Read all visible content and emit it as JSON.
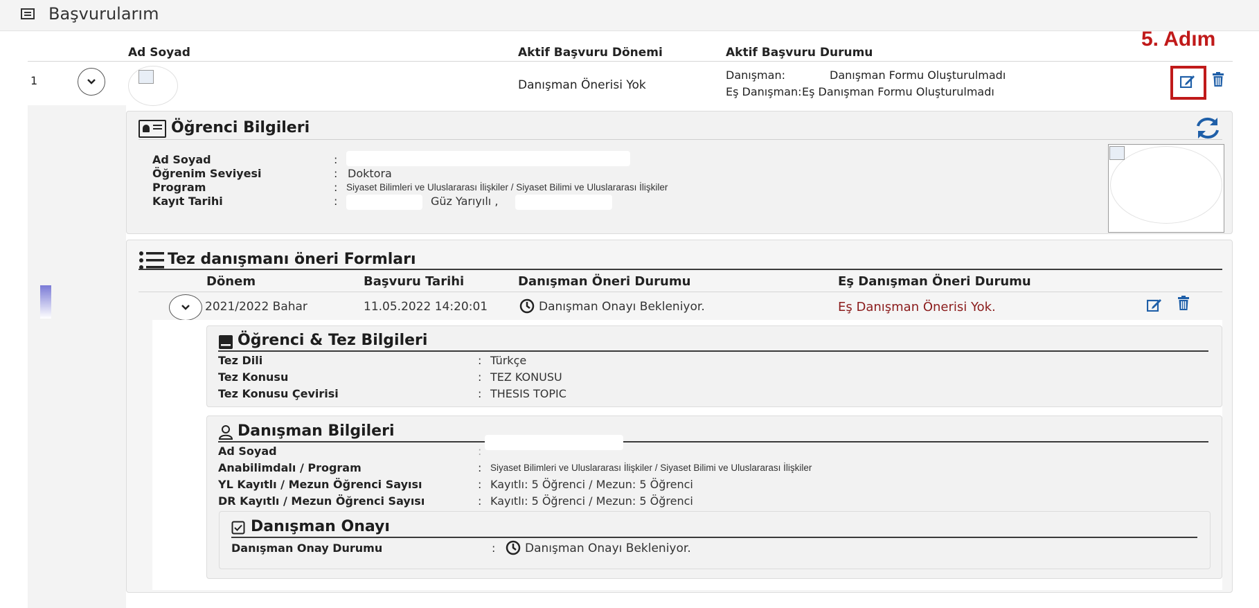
{
  "header": {
    "title": "Başvurularım",
    "icon": "list-icon"
  },
  "annotation": {
    "step_label": "5. Adım",
    "color": "#c01a1a"
  },
  "columns": {
    "ad_soyad": "Ad Soyad",
    "donem": "Aktif Başvuru Dönemi",
    "durum": "Aktif Başvuru Durumu"
  },
  "row": {
    "index": "1",
    "donem": "Danışman Önerisi Yok",
    "danisman_label": "Danışman:",
    "danisman_value": "Danışman Formu Oluşturulmadı",
    "es_danisman_label": "Eş Danışman:",
    "es_danisman_value": "Eş Danışman Formu Oluşturulmadı"
  },
  "ogrenci": {
    "title": "Öğrenci Bilgileri",
    "fields": [
      {
        "label": "Ad Soyad",
        "value": ""
      },
      {
        "label": "Öğrenim Seviyesi",
        "value": "Doktora"
      },
      {
        "label": "Program",
        "value": "Siyaset Bilimleri ve Uluslararası İlişkiler / Siyaset Bilimi ve Uluslararası İlişkiler"
      },
      {
        "label": "Kayıt Tarihi",
        "value": "Güz Yarıyılı ,"
      }
    ],
    "separator": ":"
  },
  "tez": {
    "title": "Tez danışmanı öneri Formları",
    "columns": {
      "donem": "Dönem",
      "tarih": "Başvuru Tarihi",
      "danisman": "Danışman Öneri Durumu",
      "es": "Eş Danışman Öneri Durumu"
    },
    "row": {
      "donem": "2021/2022 Bahar",
      "tarih": "11.05.2022 14:20:01",
      "danisman": "Danışman Onayı Bekleniyor.",
      "es": "Eş Danışman Önerisi Yok.",
      "es_color": "#8b1c1c"
    }
  },
  "ogrenci_tez": {
    "title": "Öğrenci & Tez Bilgileri",
    "fields": [
      {
        "label": "Tez Dili",
        "value": "Türkçe"
      },
      {
        "label": "Tez Konusu",
        "value": "TEZ KONUSU"
      },
      {
        "label": "Tez Konusu Çevirisi",
        "value": "THESIS TOPIC"
      }
    ]
  },
  "danisman_bilgi": {
    "title": "Danışman Bilgileri",
    "fields": [
      {
        "label": "Ad Soyad",
        "value": ""
      },
      {
        "label": "Anabilimdalı / Program",
        "value": "Siyaset Bilimleri ve Uluslararası İlişkiler / Siyaset Bilimi ve Uluslararası İlişkiler"
      },
      {
        "label": "YL Kayıtlı / Mezun Öğrenci Sayısı",
        "value": "Kayıtlı: 5 Öğrenci / Mezun: 5 Öğrenci"
      },
      {
        "label": "DR Kayıtlı / Mezun Öğrenci Sayısı",
        "value": "Kayıtlı: 5 Öğrenci / Mezun: 5 Öğrenci"
      }
    ]
  },
  "onay": {
    "title": "Danışman Onayı",
    "label": "Danışman Onay Durumu",
    "value": "Danışman Onayı Bekleniyor."
  },
  "colors": {
    "accent_blue": "#1f5fa8",
    "red": "#c01a1a"
  }
}
